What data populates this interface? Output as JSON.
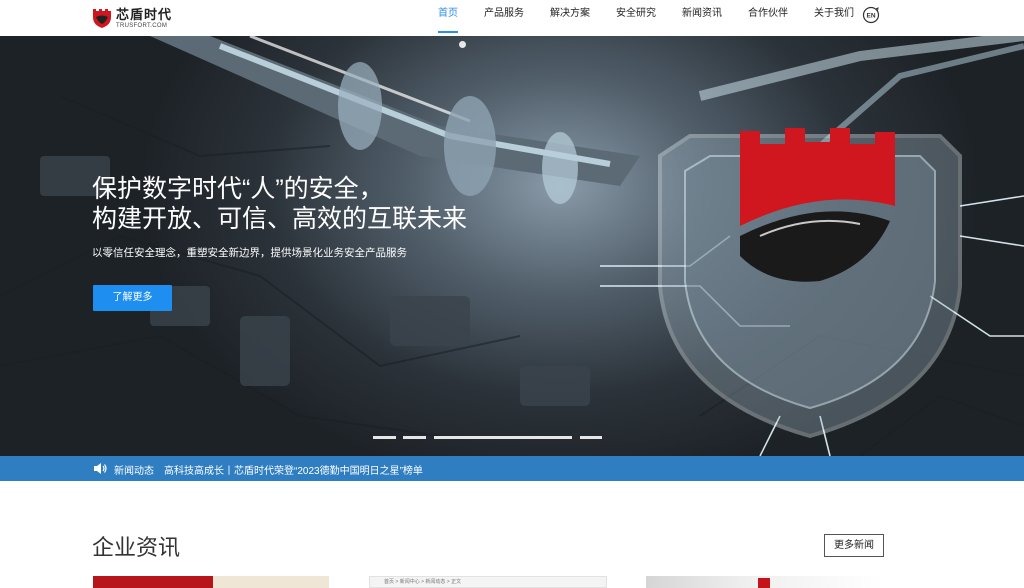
{
  "header": {
    "logo_cn": "芯盾时代",
    "logo_en": "TRUSFORT.COM",
    "nav": [
      {
        "label": "首页",
        "active": true
      },
      {
        "label": "产品服务",
        "active": false
      },
      {
        "label": "解决方案",
        "active": false
      },
      {
        "label": "安全研究",
        "active": false
      },
      {
        "label": "新闻资讯",
        "active": false
      },
      {
        "label": "合作伙伴",
        "active": false
      },
      {
        "label": "关于我们",
        "active": false
      }
    ],
    "lang_text": "EN",
    "lang_icon": "language-globe-icon"
  },
  "hero": {
    "title_line1": "保护数字时代“人”的安全，",
    "title_line2": "构建开放、可信、高效的互联未来",
    "subtitle": "以零信任安全理念，重塑安全新边界，提供场景化业务安全产品服务",
    "button": "了解更多",
    "slide_count": 5,
    "active_slide": 3
  },
  "newsbar": {
    "icon": "speaker-icon",
    "label": "新闻动态",
    "headline": "高科技高成长丨芯盾时代荣登“2023德勤中国明日之星”榜单"
  },
  "section": {
    "title": "企业资讯",
    "more_button": "更多新闻",
    "card2_crumb": "首页 > 新闻中心 > 新闻动态 > 正文"
  },
  "colors": {
    "accent": "#1e8ef0",
    "nav_active": "#2b8fe6",
    "newsbar": "#2f7ec2",
    "brand_red": "#d0161e"
  }
}
